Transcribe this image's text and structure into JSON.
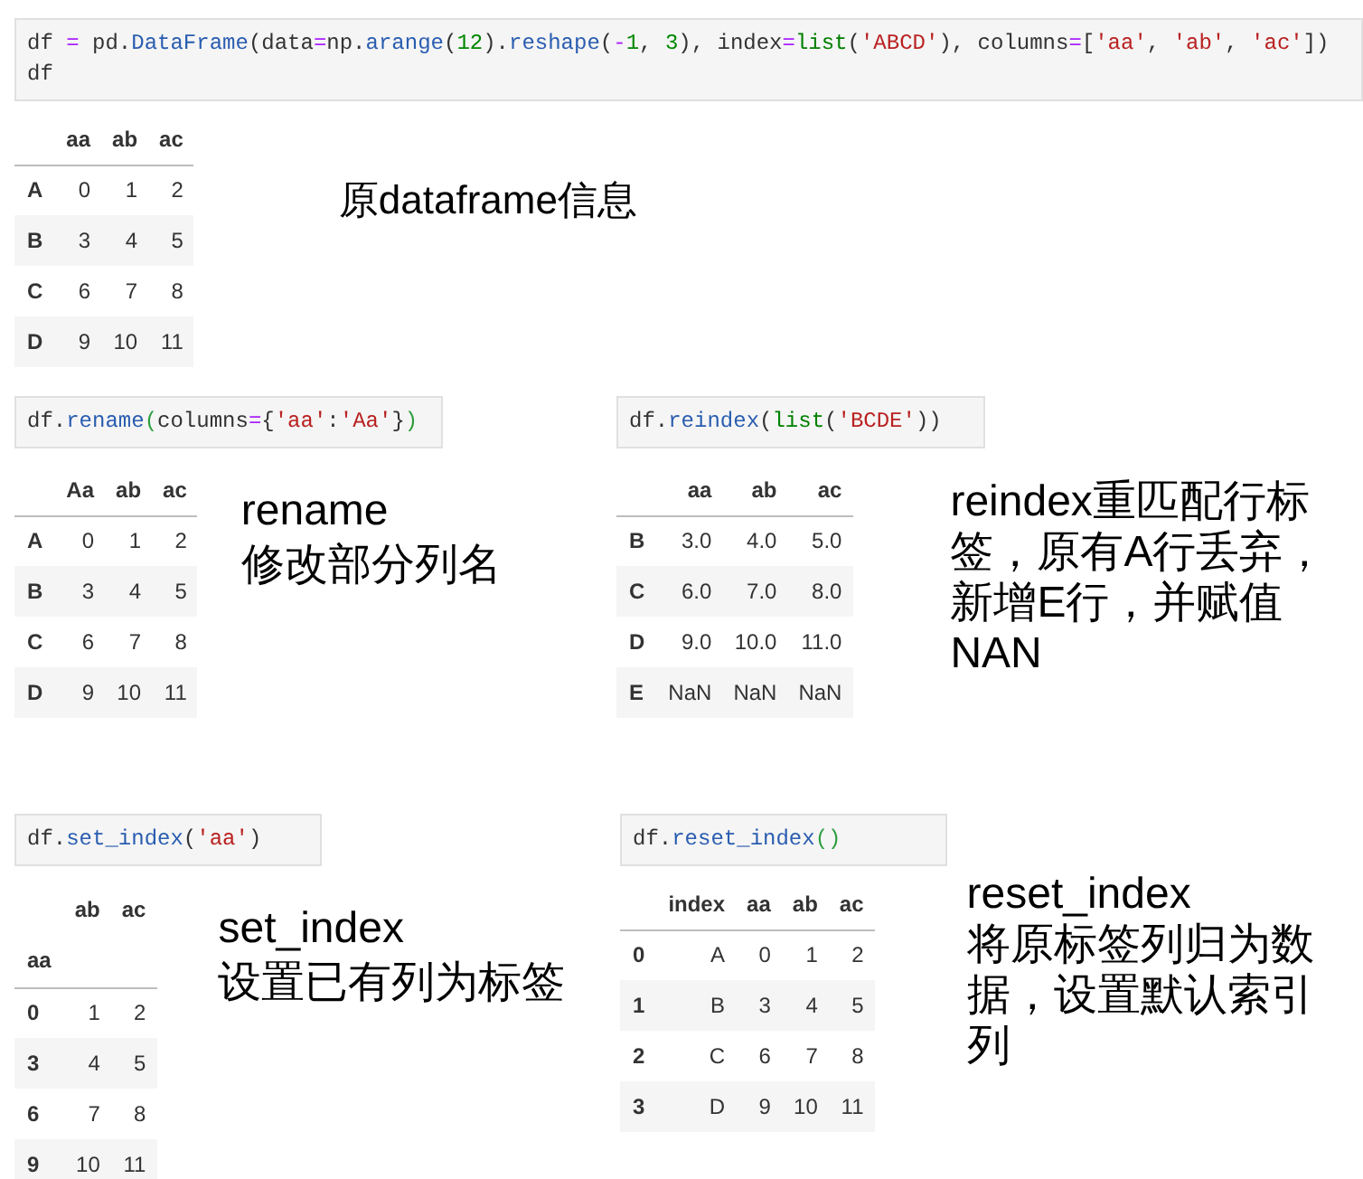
{
  "sections": [
    {
      "panels": [
        {
          "code": [
            [
              {
                "text": "df ",
                "kind": "plain"
              },
              {
                "text": "=",
                "kind": "op"
              },
              {
                "text": " pd.",
                "kind": "plain"
              },
              {
                "text": "DataFrame",
                "kind": "fn"
              },
              {
                "text": "(data",
                "kind": "plain"
              },
              {
                "text": "=",
                "kind": "op"
              },
              {
                "text": "np.",
                "kind": "plain"
              },
              {
                "text": "arange",
                "kind": "fn"
              },
              {
                "text": "(",
                "kind": "plain"
              },
              {
                "text": "12",
                "kind": "num"
              },
              {
                "text": ").",
                "kind": "plain"
              },
              {
                "text": "reshape",
                "kind": "fn"
              },
              {
                "text": "(",
                "kind": "plain"
              },
              {
                "text": "-",
                "kind": "op"
              },
              {
                "text": "1",
                "kind": "num"
              },
              {
                "text": ", ",
                "kind": "plain"
              },
              {
                "text": "3",
                "kind": "num"
              },
              {
                "text": "), index",
                "kind": "plain"
              },
              {
                "text": "=",
                "kind": "op"
              },
              {
                "text": "list",
                "kind": "builtin"
              },
              {
                "text": "(",
                "kind": "plain"
              },
              {
                "text": "'ABCD'",
                "kind": "str"
              },
              {
                "text": "), columns",
                "kind": "plain"
              },
              {
                "text": "=",
                "kind": "op"
              },
              {
                "text": "[",
                "kind": "plain"
              },
              {
                "text": "'aa'",
                "kind": "str"
              },
              {
                "text": ", ",
                "kind": "plain"
              },
              {
                "text": "'ab'",
                "kind": "str"
              },
              {
                "text": ", ",
                "kind": "plain"
              },
              {
                "text": "'ac'",
                "kind": "str"
              },
              {
                "text": "])",
                "kind": "plain"
              }
            ],
            [
              {
                "text": "df",
                "kind": "plain"
              }
            ]
          ],
          "table": {
            "columns": [
              "aa",
              "ab",
              "ac"
            ],
            "rows": [
              {
                "index": "A",
                "cells": [
                  "0",
                  "1",
                  "2"
                ]
              },
              {
                "index": "B",
                "cells": [
                  "3",
                  "4",
                  "5"
                ]
              },
              {
                "index": "C",
                "cells": [
                  "6",
                  "7",
                  "8"
                ]
              },
              {
                "index": "D",
                "cells": [
                  "9",
                  "10",
                  "11"
                ]
              }
            ]
          },
          "note_lines": [
            "原dataframe信息"
          ]
        }
      ]
    },
    {
      "panels": [
        {
          "code": [
            [
              {
                "text": "df.",
                "kind": "plain"
              },
              {
                "text": "rename",
                "kind": "fn"
              },
              {
                "text": "(",
                "kind": "bracket"
              },
              {
                "text": "columns",
                "kind": "plain"
              },
              {
                "text": "=",
                "kind": "op"
              },
              {
                "text": "{",
                "kind": "plain"
              },
              {
                "text": "'aa'",
                "kind": "str"
              },
              {
                "text": ":",
                "kind": "plain"
              },
              {
                "text": "'Aa'",
                "kind": "str"
              },
              {
                "text": "}",
                "kind": "plain"
              },
              {
                "text": ")",
                "kind": "bracket"
              }
            ]
          ],
          "table": {
            "columns": [
              "Aa",
              "ab",
              "ac"
            ],
            "rows": [
              {
                "index": "A",
                "cells": [
                  "0",
                  "1",
                  "2"
                ]
              },
              {
                "index": "B",
                "cells": [
                  "3",
                  "4",
                  "5"
                ]
              },
              {
                "index": "C",
                "cells": [
                  "6",
                  "7",
                  "8"
                ]
              },
              {
                "index": "D",
                "cells": [
                  "9",
                  "10",
                  "11"
                ]
              }
            ]
          },
          "note_lines": [
            "rename",
            "修改部分列名"
          ]
        },
        {
          "code": [
            [
              {
                "text": "df.",
                "kind": "plain"
              },
              {
                "text": "reindex",
                "kind": "fn"
              },
              {
                "text": "(",
                "kind": "plain"
              },
              {
                "text": "list",
                "kind": "builtin"
              },
              {
                "text": "(",
                "kind": "plain"
              },
              {
                "text": "'BCDE'",
                "kind": "str"
              },
              {
                "text": "))",
                "kind": "plain"
              }
            ]
          ],
          "table": {
            "columns": [
              "aa",
              "ab",
              "ac"
            ],
            "rows": [
              {
                "index": "B",
                "cells": [
                  "3.0",
                  "4.0",
                  "5.0"
                ]
              },
              {
                "index": "C",
                "cells": [
                  "6.0",
                  "7.0",
                  "8.0"
                ]
              },
              {
                "index": "D",
                "cells": [
                  "9.0",
                  "10.0",
                  "11.0"
                ]
              },
              {
                "index": "E",
                "cells": [
                  "NaN",
                  "NaN",
                  "NaN"
                ]
              }
            ]
          },
          "note_lines": [
            "reindex重匹配行标",
            "签，原有A行丢弃，",
            "新增E行，并赋值",
            "NAN"
          ]
        }
      ]
    },
    {
      "panels": [
        {
          "code": [
            [
              {
                "text": "df.",
                "kind": "plain"
              },
              {
                "text": "set_index",
                "kind": "fn"
              },
              {
                "text": "(",
                "kind": "plain"
              },
              {
                "text": "'aa'",
                "kind": "str"
              },
              {
                "text": ")",
                "kind": "plain"
              }
            ]
          ],
          "table": {
            "columns": [
              "ab",
              "ac"
            ],
            "index_name": "aa",
            "rows": [
              {
                "index": "0",
                "cells": [
                  "1",
                  "2"
                ]
              },
              {
                "index": "3",
                "cells": [
                  "4",
                  "5"
                ]
              },
              {
                "index": "6",
                "cells": [
                  "7",
                  "8"
                ]
              },
              {
                "index": "9",
                "cells": [
                  "10",
                  "11"
                ]
              }
            ]
          },
          "note_lines": [
            "set_index",
            "设置已有列为标签"
          ]
        },
        {
          "code": [
            [
              {
                "text": "df.",
                "kind": "plain"
              },
              {
                "text": "reset_index",
                "kind": "fn"
              },
              {
                "text": "()",
                "kind": "bracket"
              }
            ]
          ],
          "table": {
            "columns": [
              "index",
              "aa",
              "ab",
              "ac"
            ],
            "rows": [
              {
                "index": "0",
                "cells": [
                  "A",
                  "0",
                  "1",
                  "2"
                ]
              },
              {
                "index": "1",
                "cells": [
                  "B",
                  "3",
                  "4",
                  "5"
                ]
              },
              {
                "index": "2",
                "cells": [
                  "C",
                  "6",
                  "7",
                  "8"
                ]
              },
              {
                "index": "3",
                "cells": [
                  "D",
                  "9",
                  "10",
                  "11"
                ]
              }
            ]
          },
          "note_lines": [
            "reset_index",
            "将原标签列归为数",
            "据，设置默认索引",
            "列"
          ]
        }
      ]
    }
  ]
}
